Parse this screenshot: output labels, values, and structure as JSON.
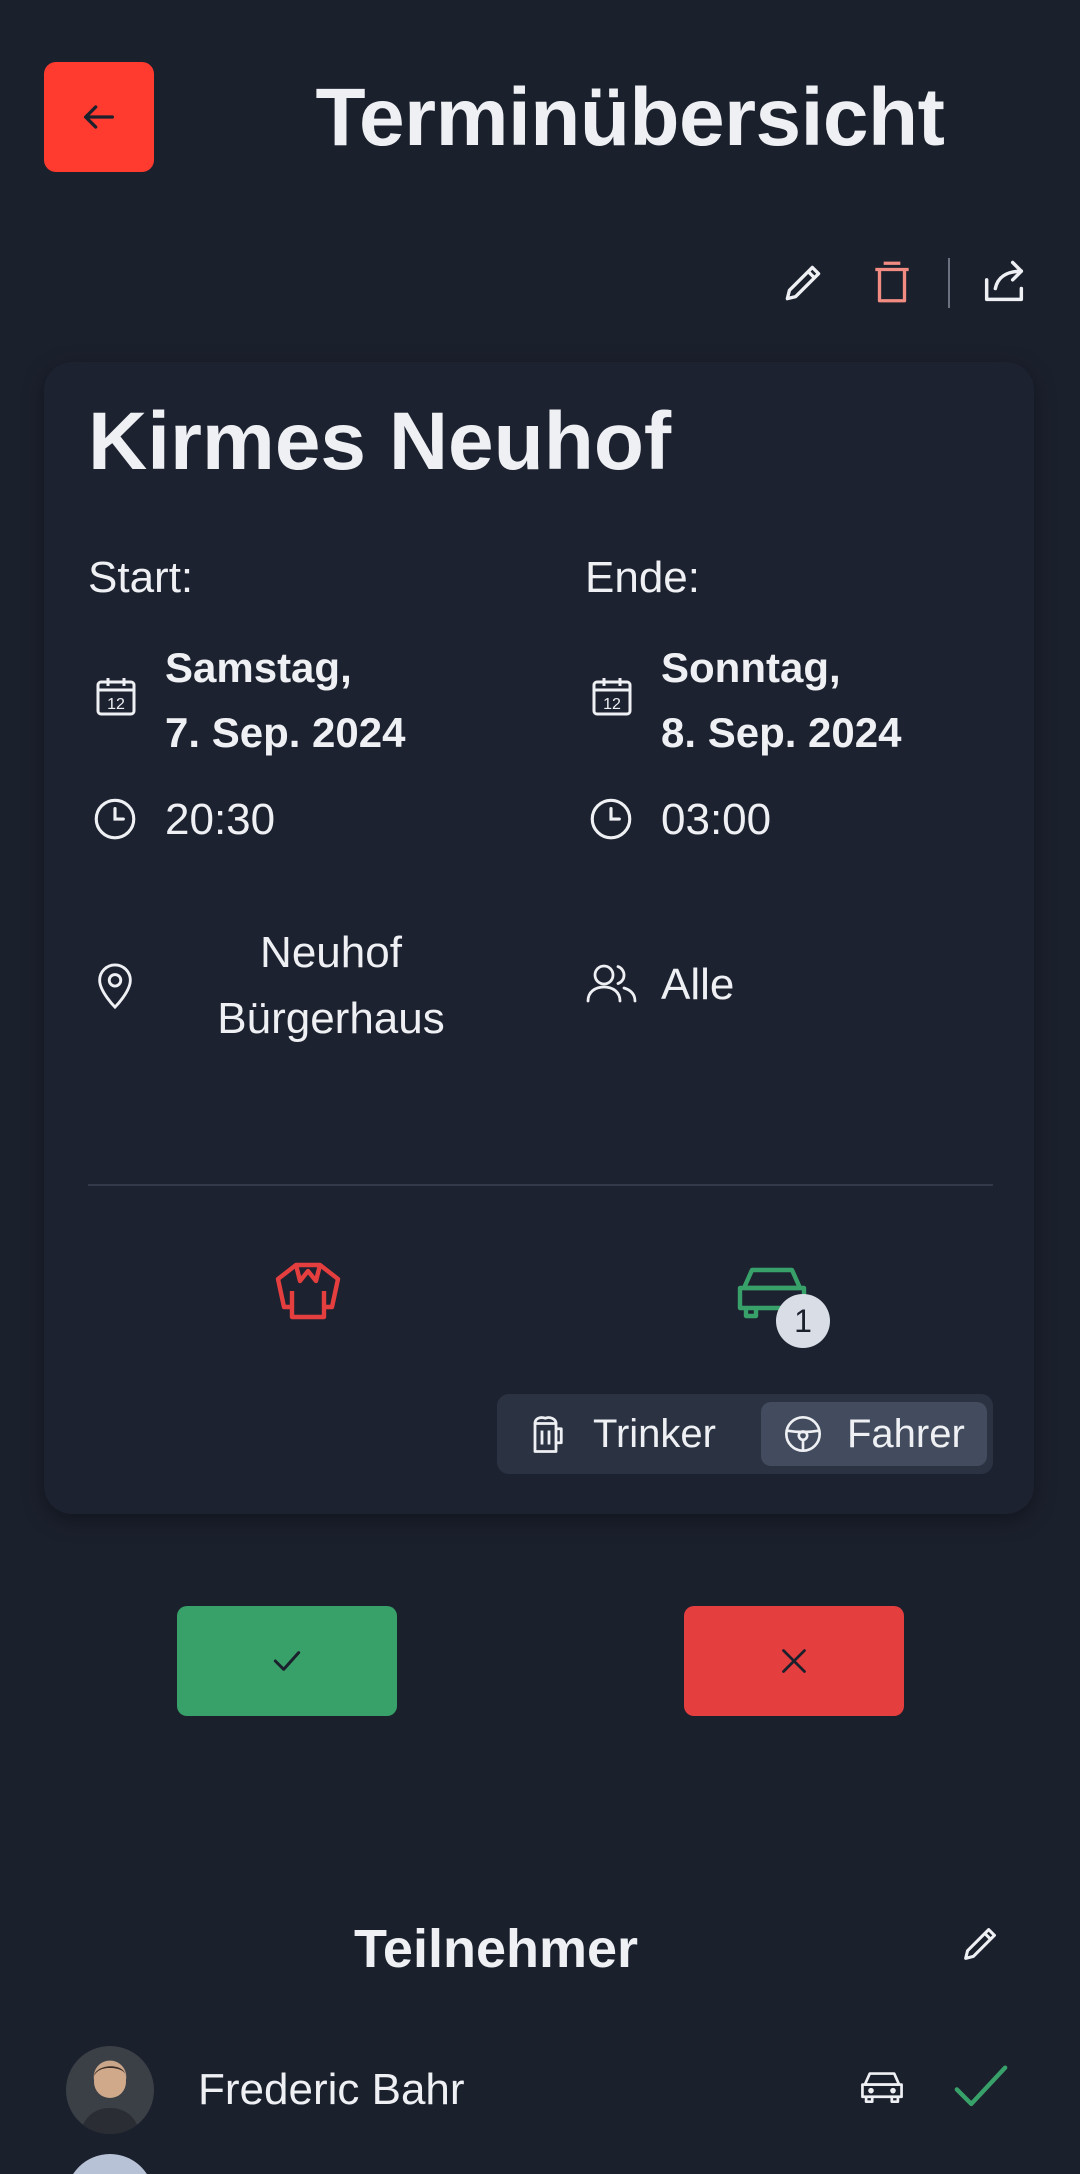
{
  "header": {
    "back_icon": "arrow-left-icon",
    "title": "Terminübersicht"
  },
  "actions": {
    "icons": [
      "pencil-icon",
      "trash-icon",
      "share-icon"
    ],
    "trash_color": "#f28b82"
  },
  "event": {
    "title": "Kirmes Neuhof",
    "start_label": "Start:",
    "end_label": "Ende:",
    "start_date_line1": "Samstag,",
    "start_date_line2": "7. Sep. 2024",
    "start_time": "20:30",
    "end_date_line1": "Sonntag,",
    "end_date_line2": "8. Sep. 2024",
    "end_time": "03:00",
    "location_line1": "Neuhof",
    "location_line2": "Bürgerhaus",
    "audience": "Alle",
    "calendar_icon_day": "12"
  },
  "roles": {
    "jacket_color": "#e53e3e",
    "car_color": "#38a169",
    "car_badge_count": "1",
    "segment_options": [
      "Trinker",
      "Fahrer"
    ],
    "active_segment": "Fahrer"
  },
  "response_buttons": {
    "accept_icon": "check-icon",
    "decline_icon": "x-icon",
    "accept_color": "#38a169",
    "decline_color": "#e53e3e"
  },
  "participants": {
    "section_title": "Teilnehmer",
    "items": [
      {
        "name": "Frederic Bahr",
        "role_icon": "car-icon",
        "status_icon": "check-icon"
      }
    ]
  }
}
